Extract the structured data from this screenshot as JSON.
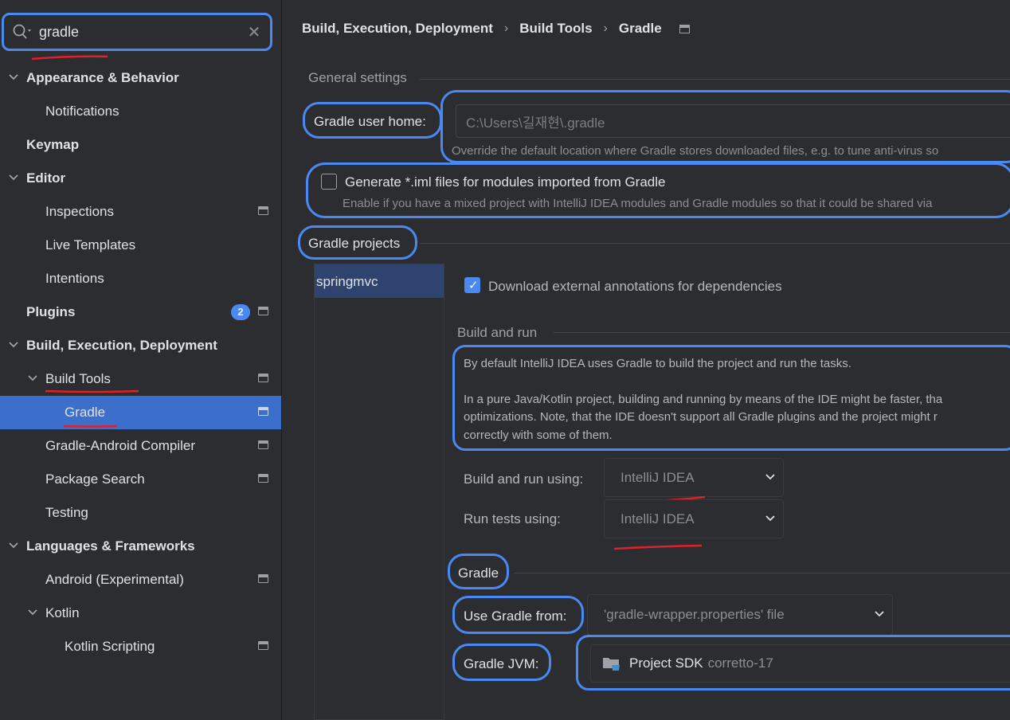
{
  "search": {
    "value": "gradle"
  },
  "sidebar": {
    "items": [
      {
        "label": "Appearance & Behavior"
      },
      {
        "label": "Notifications"
      },
      {
        "label": "Keymap"
      },
      {
        "label": "Editor"
      },
      {
        "label": "Inspections"
      },
      {
        "label": "Live Templates"
      },
      {
        "label": "Intentions"
      },
      {
        "label": "Plugins",
        "badge": "2"
      },
      {
        "label": "Build, Execution, Deployment"
      },
      {
        "label": "Build Tools"
      },
      {
        "label": "Gradle"
      },
      {
        "label": "Gradle-Android Compiler"
      },
      {
        "label": "Package Search"
      },
      {
        "label": "Testing"
      },
      {
        "label": "Languages & Frameworks"
      },
      {
        "label": "Android (Experimental)"
      },
      {
        "label": "Kotlin"
      },
      {
        "label": "Kotlin Scripting"
      }
    ]
  },
  "breadcrumb": [
    "Build, Execution, Deployment",
    "Build Tools",
    "Gradle"
  ],
  "general": {
    "title": "General settings",
    "user_home_label": "Gradle user home:",
    "user_home_value": "C:\\Users\\길재현\\.gradle",
    "user_home_hint": "Override the default location where Gradle stores downloaded files, e.g. to tune anti-virus so",
    "iml_label": "Generate *.iml files for modules imported from Gradle",
    "iml_hint": "Enable if you have a mixed project with IntelliJ IDEA modules and Gradle modules so that it could be shared via",
    "iml_checked": false
  },
  "projects": {
    "title": "Gradle projects",
    "list": [
      "springmvc"
    ],
    "download_annotations_label": "Download external annotations for dependencies",
    "download_annotations_checked": true
  },
  "build_run": {
    "title": "Build and run",
    "para1": "By default IntelliJ IDEA uses Gradle to build the project and run the tasks.",
    "para2_line1": "In a pure Java/Kotlin project, building and running by means of the IDE might be faster, tha",
    "para2_line2": "optimizations. Note, that the IDE doesn't support all Gradle plugins and the project might r",
    "para2_line3": "correctly with some of them.",
    "build_using_label": "Build and run using:",
    "build_using_value": "IntelliJ IDEA",
    "tests_using_label": "Run tests using:",
    "tests_using_value": "IntelliJ IDEA"
  },
  "gradle": {
    "title": "Gradle",
    "use_from_label": "Use Gradle from:",
    "use_from_value": "'gradle-wrapper.properties' file",
    "jvm_label": "Gradle JVM:",
    "jvm_value": "Project SDK",
    "jvm_detail": "corretto-17"
  },
  "colors": {
    "accent": "#4a88f2",
    "selection": "#3c6fcc",
    "annotation_red": "#e0202a"
  }
}
